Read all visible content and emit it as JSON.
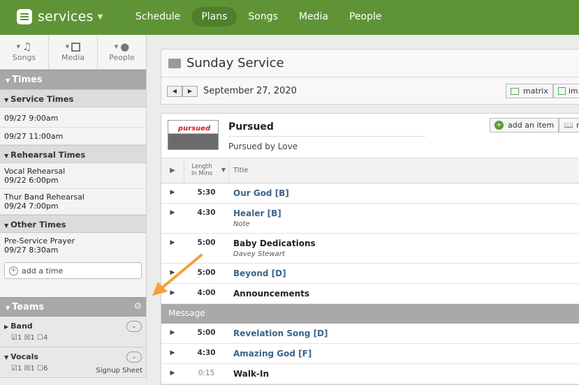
{
  "app": {
    "name": "services"
  },
  "nav": {
    "tabs": [
      "Schedule",
      "Plans",
      "Songs",
      "Media",
      "People"
    ],
    "active": "Plans"
  },
  "library": {
    "items": [
      "Songs",
      "Media",
      "People"
    ]
  },
  "sidebar": {
    "times_title": "Times",
    "service_times_title": "Service Times",
    "service_times": [
      "09/27 9:00am",
      "09/27 11:00am"
    ],
    "rehearsal_title": "Rehearsal Times",
    "rehearsals": [
      {
        "name": "Vocal Rehearsal",
        "time": "09/22 6:00pm"
      },
      {
        "name": "Thur Band Rehearsal",
        "time": "09/24 7:00pm"
      }
    ],
    "other_title": "Other Times",
    "others": [
      {
        "name": "Pre-Service Prayer",
        "time": "09/27 8:30am"
      }
    ],
    "add_time": "add a time",
    "teams_title": "Teams",
    "teams": [
      {
        "name": "Band",
        "confirmed": "1",
        "declined": "1",
        "unconfirmed": "4",
        "extra": ""
      },
      {
        "name": "Vocals",
        "confirmed": "1",
        "declined": "1",
        "unconfirmed": "6",
        "extra": "Signup Sheet"
      }
    ]
  },
  "header": {
    "title": "Sunday Service",
    "date": "September 27, 2020",
    "matrix": "matrix",
    "im": "im"
  },
  "plan": {
    "thumb_text": "pursued",
    "title": "Pursued",
    "subtitle": "Pursued by Love",
    "add_item": "add an item",
    "re": "re",
    "col_length": "Length In Mins",
    "col_title": "Title",
    "items": [
      {
        "len": "5:30",
        "title": "Our God [B]",
        "kind": "song",
        "note": ""
      },
      {
        "len": "4:30",
        "title": "Healer [B]",
        "kind": "song",
        "note": "Note"
      },
      {
        "len": "5:00",
        "title": "Baby Dedications",
        "kind": "item",
        "note": "Davey Stewart"
      },
      {
        "len": "5:00",
        "title": "Beyond [D]",
        "kind": "song",
        "note": ""
      },
      {
        "len": "4:00",
        "title": "Announcements",
        "kind": "item",
        "note": ""
      }
    ],
    "header_label": "Message",
    "items2": [
      {
        "len": "5:00",
        "title": "Revelation Song [D]",
        "kind": "song",
        "note": ""
      },
      {
        "len": "4:30",
        "title": "Amazing God [F]",
        "kind": "song",
        "note": ""
      },
      {
        "len": "0:15",
        "title": "Walk-In",
        "kind": "item",
        "note": ""
      }
    ]
  }
}
